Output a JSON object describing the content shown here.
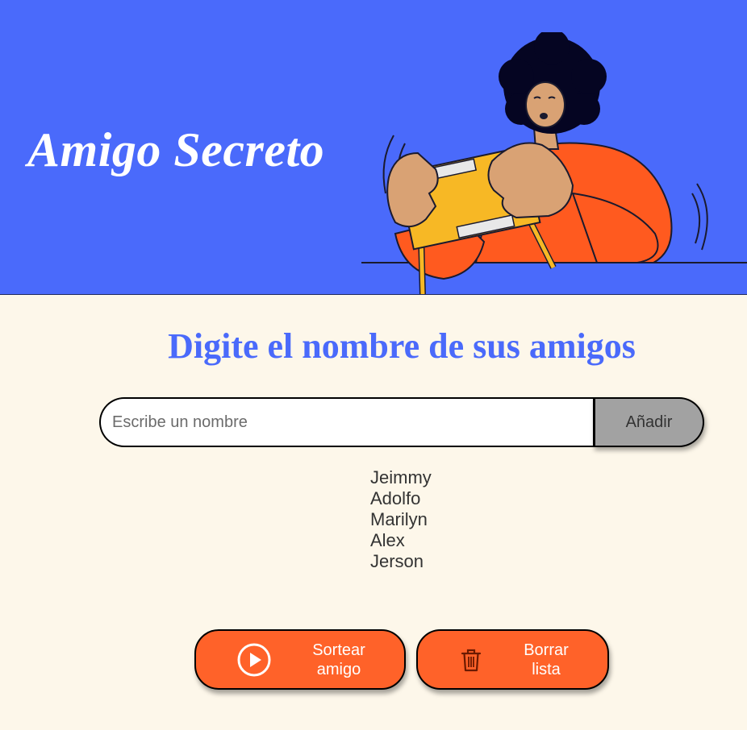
{
  "header": {
    "title": "Amigo Secreto",
    "illustration": "person-holding-gift-box",
    "background_color": "#4a6afb"
  },
  "main": {
    "heading": "Digite el nombre de sus amigos",
    "input": {
      "placeholder": "Escribe un nombre",
      "value": ""
    },
    "add_button_label": "Añadir",
    "friends": [
      "Jeimmy",
      "Adolfo",
      "Marilyn",
      "Alex",
      "Jerson"
    ],
    "draw_button": {
      "label_line1": "Sortear",
      "label_line2": "amigo",
      "icon": "play-circle-icon"
    },
    "clear_button": {
      "label_line1": "Borrar",
      "label_line2": "lista",
      "icon": "trash-icon"
    }
  },
  "colors": {
    "accent": "#4a6afb",
    "action": "#ff6229",
    "background": "#fdf7ea",
    "add_button": "#a2a2a2"
  }
}
